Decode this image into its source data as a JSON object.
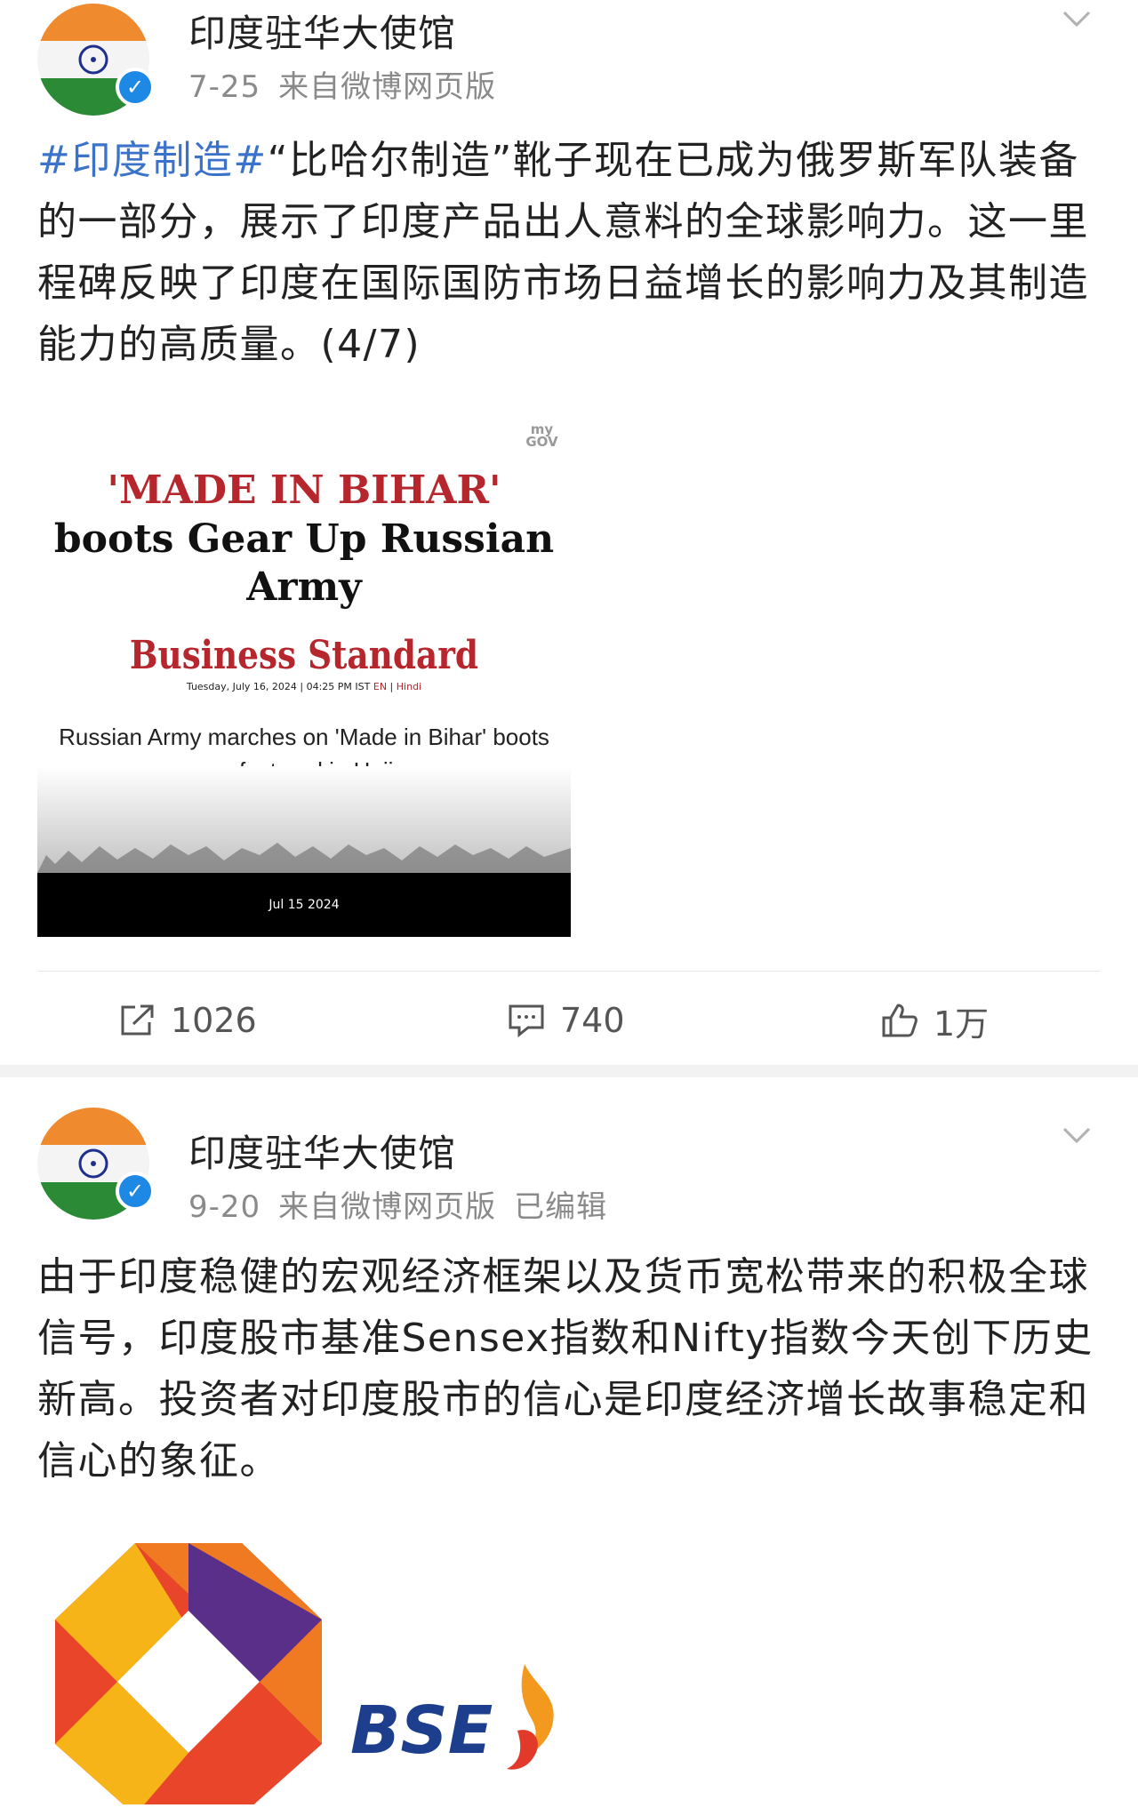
{
  "posts": [
    {
      "author": "印度驻华大使馆",
      "date": "7-25",
      "source": "来自微博网页版",
      "hashtag": "#印度制造#",
      "text": "“比哈尔制造”靴子现在已成为俄罗斯军队装备的一部分，展示了印度产品出人意料的全球影响力。这一里程碑反映了印度在国际国防市场日益增长的影响力及其制造能力的高质量。(4/7)",
      "image": {
        "logo": "my GOV",
        "headline_red": "'MADE IN BIHAR'",
        "headline_black": "boots Gear Up Russian Army",
        "brand": "Business Standard",
        "dateline": "Tuesday, July 16, 2024 | 04:25 PM IST",
        "lang_en": "EN",
        "lang_hindi": "Hindi",
        "subhead": "Russian Army marches on 'Made in Bihar' boots manufactured in Hajipur",
        "footer_date": "Jul 15 2024"
      },
      "actions": {
        "repost": "1026",
        "comment": "740",
        "like": "1万"
      }
    },
    {
      "author": "印度驻华大使馆",
      "date": "9-20",
      "source": "来自微博网页版",
      "edited": "已编辑",
      "text": "由于印度稳健的宏观经济框架以及货币宽松带来的积极全球信号，印度股市基准Sensex指数和Nifty指数今天创下历史新高。投资者对印度股市的信心是印度经济增长故事稳定和信心的象征。",
      "image": {
        "logo_text": "BSE"
      }
    }
  ],
  "colors": {
    "hashtag": "#3a73c9",
    "meta": "#8a8a8a",
    "verified": "#1e88e5",
    "bse_blue": "#1c3e8c"
  }
}
